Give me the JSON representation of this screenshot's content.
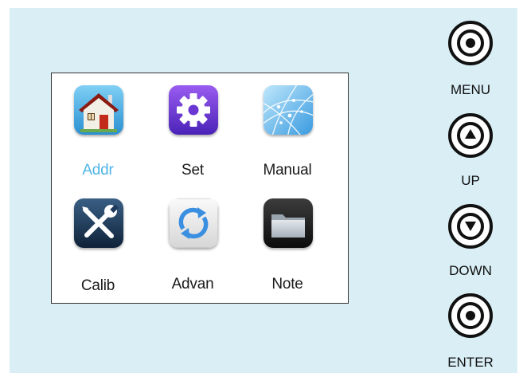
{
  "apps": [
    {
      "label": "Addr",
      "icon": "home-icon",
      "selected": true
    },
    {
      "label": "Set",
      "icon": "gear-icon",
      "selected": false
    },
    {
      "label": "Manual",
      "icon": "globe-network-icon",
      "selected": false
    },
    {
      "label": "Calib",
      "icon": "tools-icon",
      "selected": false
    },
    {
      "label": "Advan",
      "icon": "refresh-icon",
      "selected": false
    },
    {
      "label": "Note",
      "icon": "folder-icon",
      "selected": false
    }
  ],
  "buttons": {
    "menu": "MENU",
    "up": "UP",
    "down": "DOWN",
    "enter": "ENTER"
  },
  "colors": {
    "panel_background": "#d9eef5",
    "selected_label": "#4fb5e6"
  }
}
